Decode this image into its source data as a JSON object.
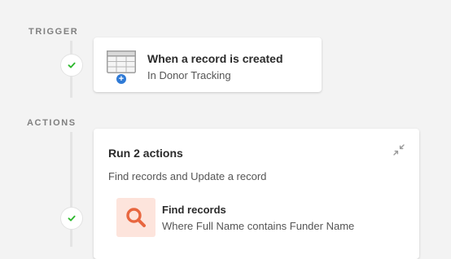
{
  "trigger": {
    "section_label": "TRIGGER",
    "title": "When a record is created",
    "subtitle": "In Donor Tracking",
    "icon": "table-icon",
    "badge_icon": "plus-icon"
  },
  "actions": {
    "section_label": "ACTIONS",
    "title": "Run 2 actions",
    "summary": "Find records and Update a record",
    "collapse_icon": "collapse-icon",
    "steps": [
      {
        "title": "Find records",
        "subtitle": "Where Full Name contains Funder Name",
        "icon": "search-icon"
      }
    ]
  },
  "colors": {
    "background": "#f3f3f3",
    "check_green": "#2eb82e",
    "search_accent": "#e8663f",
    "search_tile_bg": "#fde4dc",
    "badge_blue": "#2f7ad6"
  }
}
